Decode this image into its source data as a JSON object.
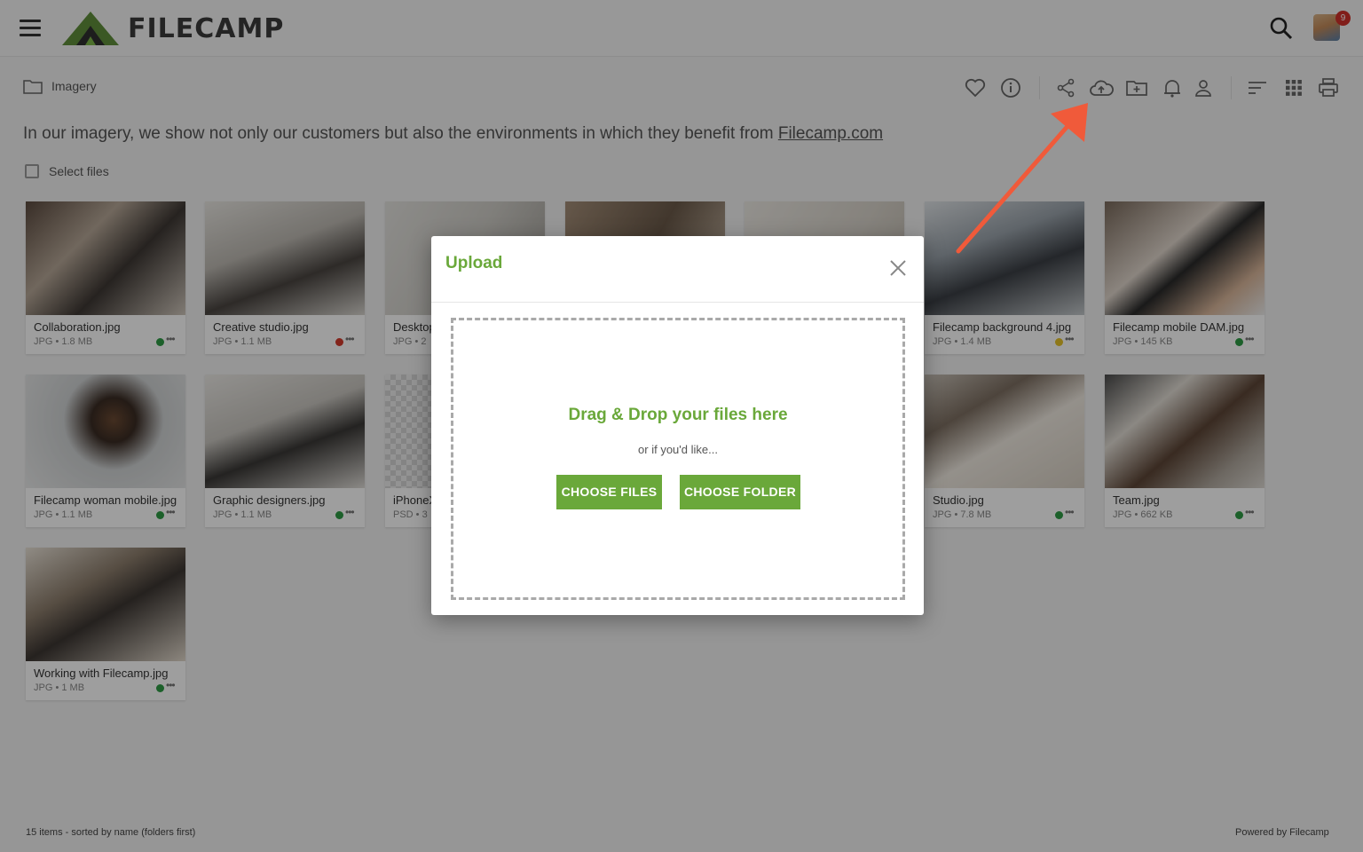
{
  "header": {
    "logo_text": "FILECAMP",
    "notification_count": "9"
  },
  "toolbar": {
    "breadcrumb": "Imagery",
    "icons": [
      "heart-icon",
      "info-icon",
      "share-icon",
      "upload-icon",
      "new-folder-icon",
      "bell-icon",
      "user-icon",
      "sort-icon",
      "grid-icon",
      "print-icon"
    ]
  },
  "folder": {
    "description": "In our imagery, we show not only our customers but also the environments in which they benefit from ",
    "description_link": "Filecamp.com",
    "select_files_label": "Select files"
  },
  "files": [
    {
      "name": "Collaboration.jpg",
      "meta": "JPG • 1.8 MB",
      "status_color": "#2e9b45"
    },
    {
      "name": "Creative studio.jpg",
      "meta": "JPG • 1.1 MB",
      "status_color": "#d33a2c"
    },
    {
      "name": "Desktop",
      "meta": "JPG • 2",
      "status_color": ""
    },
    {
      "name": "",
      "meta": "",
      "status_color": ""
    },
    {
      "name": "",
      "meta": "",
      "status_color": ""
    },
    {
      "name": "Filecamp background 4.jpg",
      "meta": "JPG • 1.4 MB",
      "status_color": "#e6c229"
    },
    {
      "name": "Filecamp mobile DAM.jpg",
      "meta": "JPG • 145 KB",
      "status_color": "#2e9b45"
    },
    {
      "name": "Filecamp woman mobile.jpg",
      "meta": "JPG • 1.1 MB",
      "status_color": "#2e9b45"
    },
    {
      "name": "Graphic designers.jpg",
      "meta": "JPG • 1.1 MB",
      "status_color": "#2e9b45"
    },
    {
      "name": "iPhoneX",
      "meta": "PSD • 3",
      "status_color": ""
    },
    {
      "name": "Studio.jpg",
      "meta": "JPG • 7.8 MB",
      "status_color": "#2e9b45"
    },
    {
      "name": "Team.jpg",
      "meta": "JPG • 662 KB",
      "status_color": "#2e9b45"
    },
    {
      "name": "Working with Filecamp.jpg",
      "meta": "JPG • 1 MB",
      "status_color": "#2e9b45"
    }
  ],
  "footer": {
    "left": "15 items - sorted by name (folders first)",
    "right": "Powered by Filecamp"
  },
  "modal": {
    "title": "Upload",
    "drop_title": "Drag & Drop your files here",
    "drop_subtitle": "or if you'd like...",
    "choose_files_label": "CHOOSE FILES",
    "choose_folder_label": "CHOOSE FOLDER"
  },
  "colors": {
    "brand_green": "#6aa83a",
    "arrow_red": "#f05a3a"
  }
}
